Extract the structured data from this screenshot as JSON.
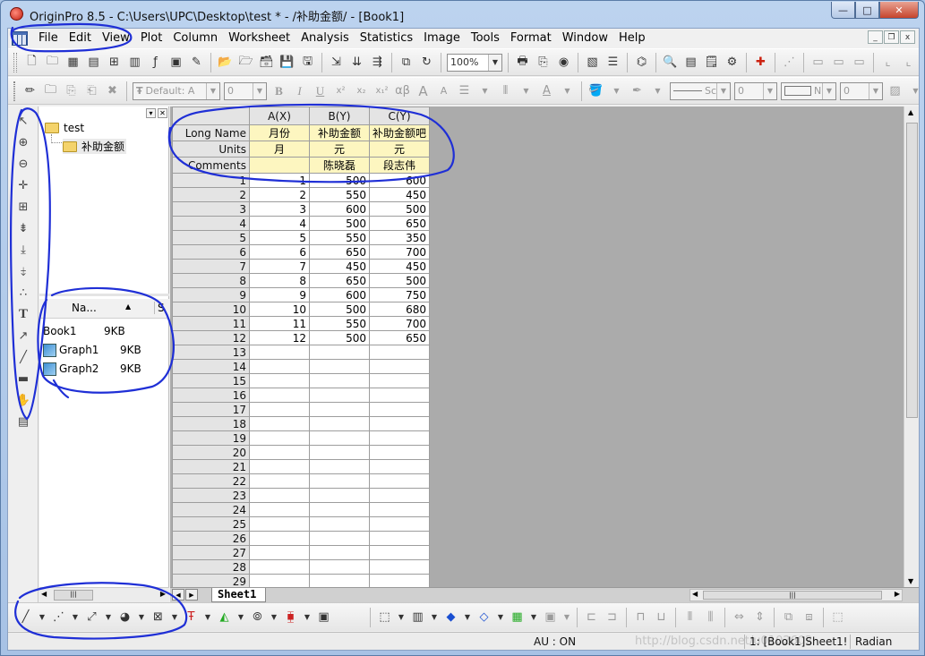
{
  "window": {
    "title": "OriginPro 8.5 - C:\\Users\\UPC\\Desktop\\test * - /补助金额/ - [Book1]",
    "minimize_glyph": "—",
    "maximize_glyph": "□",
    "close_glyph": "✕"
  },
  "menu": {
    "items": [
      "File",
      "Edit",
      "View",
      "Plot",
      "Column",
      "Worksheet",
      "Analysis",
      "Statistics",
      "Image",
      "Tools",
      "Format",
      "Window",
      "Help"
    ],
    "mdi_minimize": "_",
    "mdi_restore": "❐",
    "mdi_close": "x"
  },
  "toolbar": {
    "zoom_value": "100%",
    "font_value": "Default: A",
    "font_size_value": "0",
    "bold_label": "B",
    "italic_label": "I",
    "underline_label": "U",
    "superscript_label": "x²",
    "subscript_label": "x₂",
    "supersub_label": "x₁²",
    "greek_label": "αβ",
    "increase_font_label": "A",
    "decrease_font_label": "A",
    "text_color_label": "A",
    "line_style_value": "Sc",
    "line_width_value": "0",
    "fill_value": "N",
    "fill_width_value": "0"
  },
  "explorer": {
    "root_folder": "test",
    "sub_folder": "补助金额",
    "list_header_name": "Na...",
    "list_header_size": "S",
    "items": [
      {
        "name": "Book1",
        "size": "9KB",
        "kind": "book"
      },
      {
        "name": "Graph1",
        "size": "9KB",
        "kind": "graph"
      },
      {
        "name": "Graph2",
        "size": "9KB",
        "kind": "graph"
      }
    ]
  },
  "worksheet": {
    "columns": [
      "A(X)",
      "B(Y)",
      "C(Y)"
    ],
    "meta_rows": [
      {
        "label": "Long Name",
        "values": [
          "月份",
          "补助金额",
          "补助金额吧"
        ]
      },
      {
        "label": "Units",
        "values": [
          "月",
          "元",
          "元"
        ]
      },
      {
        "label": "Comments",
        "values": [
          "",
          "陈晓磊",
          "段志伟"
        ]
      }
    ],
    "rows": [
      [
        "1",
        "500",
        "600"
      ],
      [
        "2",
        "550",
        "450"
      ],
      [
        "3",
        "600",
        "500"
      ],
      [
        "4",
        "500",
        "650"
      ],
      [
        "5",
        "550",
        "350"
      ],
      [
        "6",
        "650",
        "700"
      ],
      [
        "7",
        "450",
        "450"
      ],
      [
        "8",
        "650",
        "500"
      ],
      [
        "9",
        "600",
        "750"
      ],
      [
        "10",
        "500",
        "680"
      ],
      [
        "11",
        "550",
        "700"
      ],
      [
        "12",
        "500",
        "650"
      ]
    ],
    "empty_row_count": 17,
    "sheet_tab": "Sheet1"
  },
  "statusbar": {
    "au": "AU : ON",
    "watermark": "http://blog.csdn.net/u0102602",
    "active": "1: [Book1]Sheet1!",
    "angle": "Radian"
  },
  "colors": {
    "title_bar": "#a7c2e5",
    "metadata_fill": "#fdf6c0",
    "annotation_ink": "#1f2fd6"
  }
}
